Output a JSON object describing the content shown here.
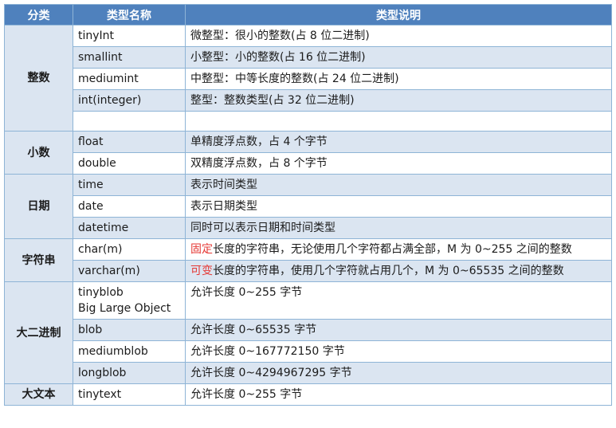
{
  "header": {
    "col1": "分类",
    "col2": "类型名称",
    "col3": "类型说明"
  },
  "groups": [
    {
      "category": "整数",
      "rows": [
        {
          "name": "tinyInt",
          "desc": "微整型：很小的整数(占 8 位二进制)"
        },
        {
          "name": "smallint",
          "desc": "小整型：小的整数(占 16 位二进制)"
        },
        {
          "name": "mediumint",
          "desc": "中整型：中等长度的整数(占 24 位二进制)"
        },
        {
          "name": "int(integer)",
          "desc": "整型：整数类型(占 32 位二进制)"
        },
        {
          "name": "",
          "desc": ""
        }
      ]
    },
    {
      "category": "小数",
      "rows": [
        {
          "name": "float",
          "desc": "单精度浮点数，占 4 个字节"
        },
        {
          "name": "double",
          "desc": "双精度浮点数，占 8 个字节"
        }
      ]
    },
    {
      "category": "日期",
      "rows": [
        {
          "name": "time",
          "desc": "表示时间类型"
        },
        {
          "name": "date",
          "desc": "表示日期类型"
        },
        {
          "name": "datetime",
          "desc": "同时可以表示日期和时间类型"
        }
      ]
    },
    {
      "category": "字符串",
      "rows": [
        {
          "name": "char(m)",
          "desc_hl": "固定",
          "desc": "长度的字符串，无论使用几个字符都占满全部，M 为 0~255 之间的整数"
        },
        {
          "name": "varchar(m)",
          "desc_hl": "可变",
          "desc": "长度的字符串，使用几个字符就占用几个，M 为 0~65535 之间的整数"
        }
      ]
    },
    {
      "category": "大二进制",
      "rows": [
        {
          "name": "tinyblob",
          "name2": "Big Large Object",
          "desc": "允许长度 0~255 字节"
        },
        {
          "name": "blob",
          "desc": "允许长度 0~65535 字节"
        },
        {
          "name": "mediumblob",
          "desc": "允许长度 0~167772150 字节"
        },
        {
          "name": "longblob",
          "desc": "允许长度 0~4294967295 字节"
        }
      ]
    },
    {
      "category": "大文本",
      "rows": [
        {
          "name": "tinytext",
          "desc": "允许长度 0~255 字节"
        }
      ]
    }
  ],
  "colors": {
    "header": "#4f81bd",
    "band": "#dbe5f1",
    "border": "#8eb4d6",
    "highlight": "#e53935"
  }
}
